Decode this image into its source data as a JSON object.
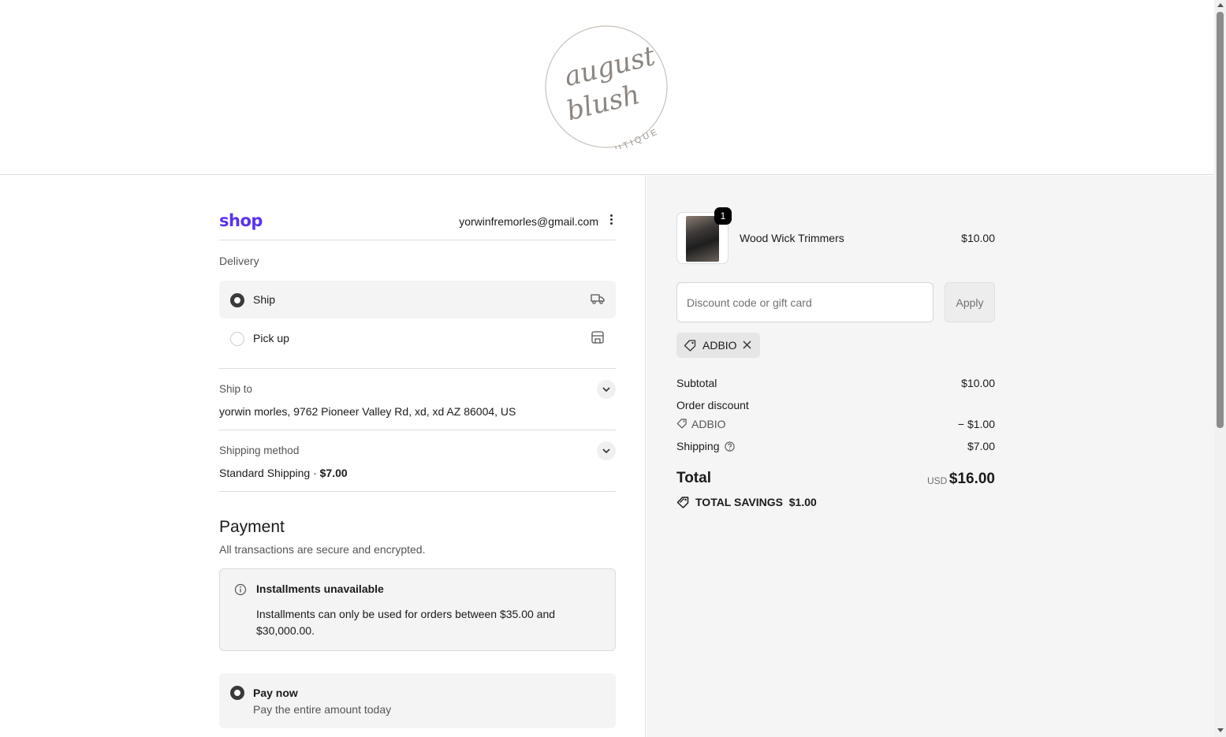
{
  "brand": {
    "logo_line1": "august",
    "logo_line2": "blush",
    "logo_line3": "BOUTIQUE"
  },
  "account": {
    "shop_logo": "shop",
    "email": "yorwinfremorles@gmail.com"
  },
  "delivery": {
    "label": "Delivery",
    "options": [
      {
        "label": "Ship",
        "selected": true,
        "icon": "truck-icon"
      },
      {
        "label": "Pick up",
        "selected": false,
        "icon": "store-icon"
      }
    ]
  },
  "ship_to": {
    "label": "Ship to",
    "value": "yorwin morles, 9762 Pioneer Valley Rd, xd, xd AZ 86004, US"
  },
  "shipping_method": {
    "label": "Shipping method",
    "name": "Standard Shipping · ",
    "price": "$7.00"
  },
  "payment": {
    "title": "Payment",
    "subtitle": "All transactions are secure and encrypted.",
    "installments_title": "Installments unavailable",
    "installments_text": "Installments can only be used for orders between $35.00 and $30,000.00.",
    "paynow_title": "Pay now",
    "paynow_sub": "Pay the entire amount today"
  },
  "cart": {
    "items": [
      {
        "name": "Wood Wick Trimmers",
        "price": "$10.00",
        "qty": "1"
      }
    ]
  },
  "discount": {
    "placeholder": "Discount code or gift card",
    "apply_label": "Apply",
    "applied_code": "ADBIO"
  },
  "summary": {
    "subtotal_label": "Subtotal",
    "subtotal_value": "$10.00",
    "order_discount_label": "Order discount",
    "discount_code": "ADBIO",
    "discount_value": "− $1.00",
    "shipping_label": "Shipping",
    "shipping_value": "$7.00",
    "total_label": "Total",
    "currency": "USD",
    "total_value": "$16.00",
    "savings_label": "TOTAL SAVINGS",
    "savings_value": "$1.00"
  },
  "colors": {
    "shop_purple": "#5a31f4",
    "summary_bg": "#f5f5f5"
  }
}
